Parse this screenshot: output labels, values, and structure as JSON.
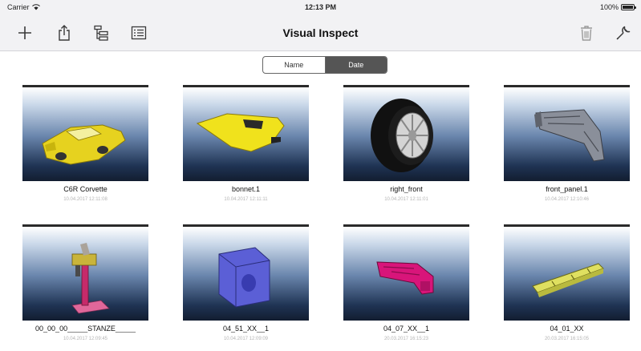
{
  "status_bar": {
    "carrier": "Carrier",
    "time": "12:13 PM",
    "battery": "100%",
    "battery_level": 1.0
  },
  "nav": {
    "title": "Visual Inspect",
    "left_icons": [
      "plus-icon",
      "share-icon",
      "hierarchy-icon",
      "list-icon"
    ],
    "right_icons": [
      "trash-icon",
      "wrench-icon"
    ]
  },
  "sort": {
    "options": [
      "Name",
      "Date"
    ],
    "selected": "Date"
  },
  "items": [
    {
      "name": "C6R Corvette",
      "date": "10.04.2017 12:11:08",
      "model": "car"
    },
    {
      "name": "bonnet.1",
      "date": "10.04.2017 12:11:11",
      "model": "bonnet"
    },
    {
      "name": "right_front",
      "date": "10.04.2017 12:11:01",
      "model": "wheel"
    },
    {
      "name": "front_panel.1",
      "date": "10.04.2017 12:10:46",
      "model": "panel"
    },
    {
      "name": "00_00_00_____STANZE_____",
      "date": "10.04.2017 12:09:45",
      "model": "stand"
    },
    {
      "name": "04_51_XX__1",
      "date": "10.04.2017 12:09:09",
      "model": "block"
    },
    {
      "name": "04_07_XX__1",
      "date": "20.03.2017 16:15:23",
      "model": "bracket"
    },
    {
      "name": "04_01_XX",
      "date": "20.03.2017 16:15:05",
      "model": "rail"
    }
  ],
  "colors": {
    "accent": "#555555",
    "toolbar": "#f2f2f4",
    "icon": "#3a3a3a"
  }
}
